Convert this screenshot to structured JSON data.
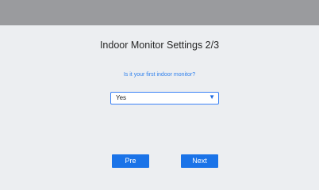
{
  "header": {
    "title": "Indoor Monitor Settings 2/3"
  },
  "form": {
    "question": "Is it your first indoor monitor?",
    "select": {
      "value": "Yes",
      "arrow_icon": "dropdown-triangle"
    }
  },
  "footer": {
    "pre_label": "Pre",
    "next_label": "Next"
  },
  "colors": {
    "accent": "#1a73e8",
    "question_text": "#2f80ed",
    "top_bar": "#9a9b9e",
    "background": "#eceef1"
  }
}
